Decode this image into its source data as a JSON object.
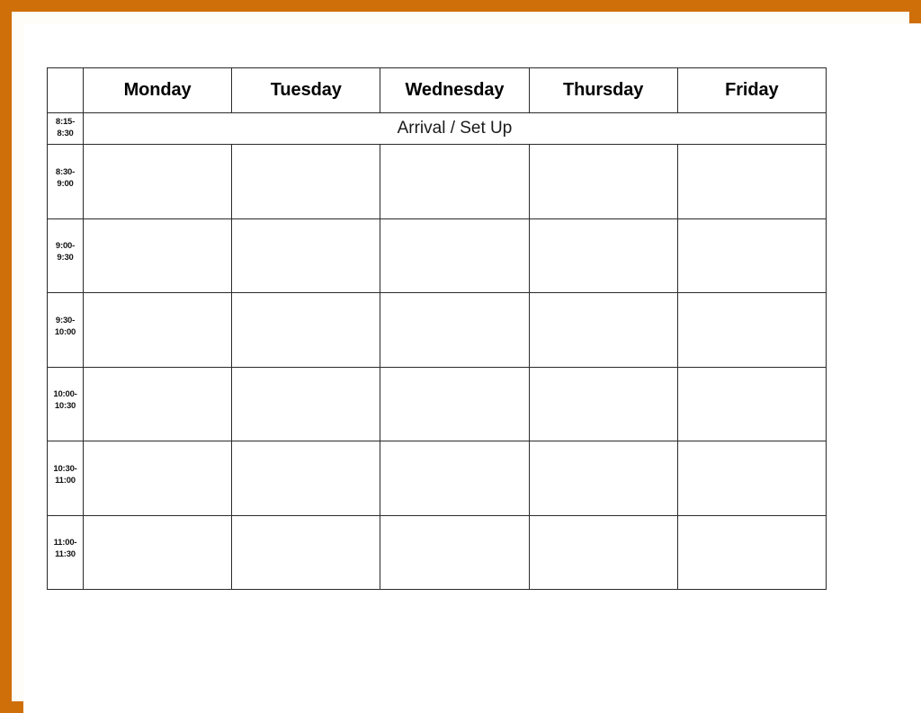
{
  "document": {
    "type": "weekly-class-schedule-template",
    "frame_color": "#CE6F09",
    "page_background": "#FFFFFF",
    "grid_line_color": "#2A2A2A"
  },
  "table": {
    "corner_label": "",
    "day_headers": [
      "Monday",
      "Tuesday",
      "Wednesday",
      "Thursday",
      "Friday"
    ],
    "arrival_row": {
      "time": "8:15-\n8:30",
      "time_line1": "8:15-",
      "time_line2": "8:30",
      "label": "Arrival / Set Up"
    },
    "rows": [
      {
        "time_line1": "8:30-",
        "time_line2": "9:00",
        "cells": [
          "",
          "",
          "",
          "",
          ""
        ]
      },
      {
        "time_line1": "9:00-",
        "time_line2": "9:30",
        "cells": [
          "",
          "",
          "",
          "",
          ""
        ]
      },
      {
        "time_line1": "9:30-",
        "time_line2": "10:00",
        "cells": [
          "",
          "",
          "",
          "",
          ""
        ]
      },
      {
        "time_line1": "10:00-",
        "time_line2": "10:30",
        "cells": [
          "",
          "",
          "",
          "",
          ""
        ]
      },
      {
        "time_line1": "10:30-",
        "time_line2": "11:00",
        "cells": [
          "",
          "",
          "",
          "",
          ""
        ]
      },
      {
        "time_line1": "11:00-",
        "time_line2": "11:30",
        "cells": [
          "",
          "",
          "",
          "",
          ""
        ]
      }
    ]
  }
}
